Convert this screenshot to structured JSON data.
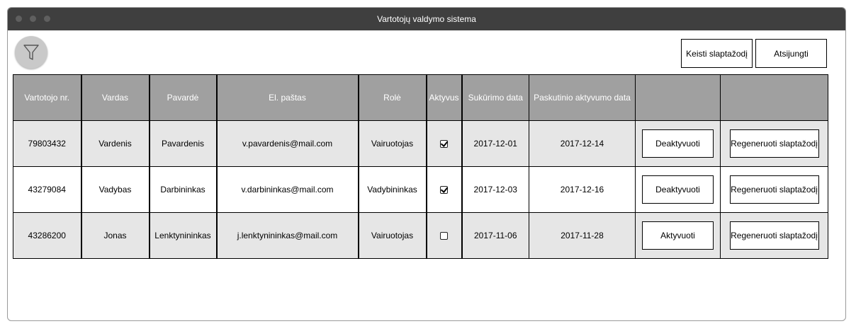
{
  "window": {
    "title": "Vartotojų valdymo sistema"
  },
  "toolbar": {
    "filter_icon": "filter-funnel-icon",
    "change_password_label": "Keisti slaptažodį",
    "logout_label": "Atsijungti"
  },
  "table": {
    "headers": {
      "id": "Vartotojo nr.",
      "first_name": "Vardas",
      "last_name": "Pavardė",
      "email": "El. paštas",
      "role": "Rolė",
      "active": "Aktyvus",
      "created": "Sukūrimo data",
      "last_active": "Paskutinio aktyvumo data",
      "action1": "",
      "action2": ""
    },
    "rows": [
      {
        "id": "79803432",
        "first_name": "Vardenis",
        "last_name": "Pavardenis",
        "email": "v.pavardenis@mail.com",
        "role": "Vairuotojas",
        "active": true,
        "created": "2017-12-01",
        "last_active": "2017-12-14",
        "toggle_label": "Deaktyvuoti",
        "regen_label": "Regeneruoti slaptažodį"
      },
      {
        "id": "43279084",
        "first_name": "Vadybas",
        "last_name": "Darbininkas",
        "email": "v.darbininkas@mail.com",
        "role": "Vadybininkas",
        "active": true,
        "created": "2017-12-03",
        "last_active": "2017-12-16",
        "toggle_label": "Deaktyvuoti",
        "regen_label": "Regeneruoti slaptažodį"
      },
      {
        "id": "43286200",
        "first_name": "Jonas",
        "last_name": "Lenktynininkas",
        "email": "j.lenktynininkas@mail.com",
        "role": "Vairuotojas",
        "active": false,
        "created": "2017-11-06",
        "last_active": "2017-11-28",
        "toggle_label": "Aktyvuoti",
        "regen_label": "Regeneruoti slaptažodį"
      }
    ]
  },
  "colors": {
    "titlebar": "#3f3f3f",
    "header_bg": "#a0a0a0",
    "row_alt": "#e6e6e6"
  }
}
